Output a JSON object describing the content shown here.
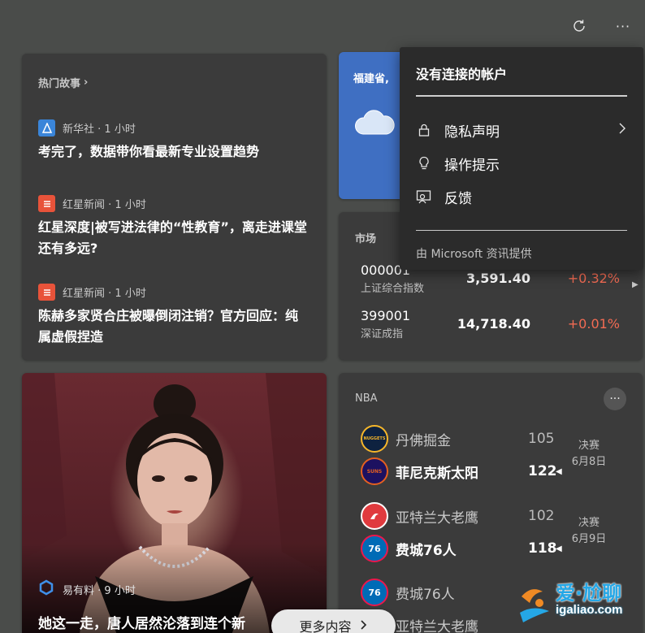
{
  "topbar": {
    "refresh_icon": "refresh-icon",
    "more_icon": "more-icon"
  },
  "news": {
    "section_title": "热门故事",
    "items": [
      {
        "source": "新华社",
        "time": " · 1 小时",
        "headline": "考完了，数据带你看最新专业设置趋势",
        "logo_color": "#3a85d9",
        "logo_text": ""
      },
      {
        "source": "红星新闻",
        "time": " · 1 小时",
        "headline": "红星深度|被写进法律的“性教育”，离走进课堂还有多远?",
        "logo_color": "#e8533a",
        "logo_text": ""
      },
      {
        "source": "红星新闻",
        "time": " · 1 小时",
        "headline": "陈赫多家贤合庄被曝倒闭注销？官方回应：纯属虚假捏造",
        "logo_color": "#e8533a",
        "logo_text": ""
      }
    ]
  },
  "weather": {
    "location": "福建省,",
    "accent": "#3f6fc2"
  },
  "market": {
    "title": "市场",
    "rows": [
      {
        "code": "000001",
        "name": "上证综合指数",
        "price": "3,591.40",
        "change": "+0.32%"
      },
      {
        "code": "399001",
        "name": "深证成指",
        "price": "14,718.40",
        "change": "+0.01%"
      }
    ],
    "positive_color": "#f36b53"
  },
  "photo_story": {
    "source": "易有料",
    "time": " · 9 小时",
    "headline": "她这一走，唐人居然沦落到连个新"
  },
  "nba": {
    "title": "NBA",
    "games": [
      {
        "team1": "丹佛掘金",
        "score1": "105",
        "team2": "菲尼克斯太阳",
        "score2": "122",
        "stage": "决赛",
        "date": "6月8日"
      },
      {
        "team1": "亚特兰大老鹰",
        "score1": "102",
        "team2": "费城76人",
        "score2": "118",
        "stage": "决赛",
        "date": "6月9日"
      },
      {
        "team1": "费城76人",
        "score1": "",
        "team2": "亚特兰大老鹰",
        "score2": "",
        "stage": "",
        "date": ""
      }
    ],
    "logo_texts": {
      "nuggets": "NUGGETS",
      "suns": "SUNS",
      "hawks": "",
      "sixers": "76"
    }
  },
  "dropdown": {
    "title": "没有连接的帐户",
    "items": [
      {
        "label": "隐私声明",
        "icon": "lock-icon"
      },
      {
        "label": "操作提示",
        "icon": "lightbulb-icon"
      },
      {
        "label": "反馈",
        "icon": "feedback-icon"
      }
    ],
    "footer": "由 Microsoft 资讯提供"
  },
  "more_button": {
    "label": "更多内容"
  },
  "watermark": {
    "text": "爱·尬聊",
    "url": "igaliao.com"
  }
}
